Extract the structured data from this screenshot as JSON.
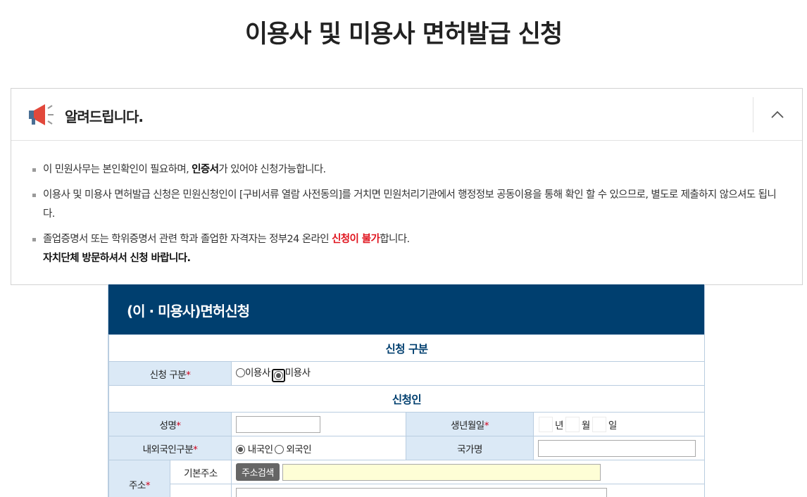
{
  "page": {
    "title": "이용사 및 미용사 면허발급 신청"
  },
  "notice": {
    "title": "알려드립니다.",
    "items": [
      {
        "text_before": "이 민원사무는 본인확인이 필요하며, ",
        "bold": "인증서",
        "text_after": "가 있어야 신청가능합니다."
      },
      {
        "text": "이용사 및 미용사 면허발급 신청은 민원신청인이 [구비서류 열람 사전동의]를 거치면 민원처리기관에서 행정정보 공동이용을 통해 확인 할 수 있으므로, 별도로 제출하지 않으셔도 됩니다."
      },
      {
        "text_before": "졸업증명서 또는 학위증명서 관련 학과 졸업한 자격자는 정부24 온라인 ",
        "red": "신청이 불가",
        "text_after": "합니다.",
        "bold_line": "자치단체 방문하셔서 신청 바랍니다."
      }
    ]
  },
  "form": {
    "header": "(이 · 미용사)면허신청",
    "section_apply": "신청 구분",
    "apply_type_label": "신청 구분",
    "apply_options": [
      "이용사",
      "미용사"
    ],
    "apply_selected": "미용사",
    "section_applicant": "신청인",
    "name_label": "성명",
    "name_value": "",
    "birth_label": "생년월일",
    "birth_units": [
      "년",
      "월",
      "일"
    ],
    "nationality_label": "내외국인구분",
    "nationality_options": [
      "내국인",
      "외국인"
    ],
    "nationality_selected": "내국인",
    "country_label": "국가명",
    "country_value": "",
    "address_label": "주소",
    "address_basic_label": "기본주소",
    "address_search_button": "주소검색",
    "address_basic_value": "",
    "required_mark": "*"
  },
  "colors": {
    "header_bg": "#003f6f",
    "label_bg": "#dbe9f6",
    "required": "#d0021b",
    "highlight_red": "#e0141e"
  }
}
